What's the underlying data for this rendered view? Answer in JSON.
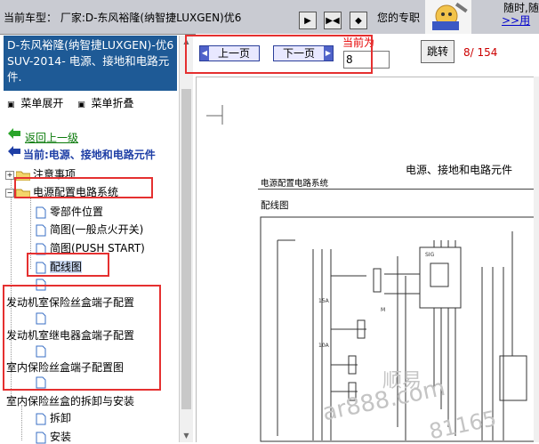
{
  "topbar": {
    "current_model_label": "当前车型：  厂家:D-东风裕隆(纳智捷LUXGEN)优6",
    "pro_text": "您的专职",
    "tip_line1": "随时,随",
    "tip_line2": ">>用"
  },
  "left": {
    "title": "D-东风裕隆(纳智捷LUXGEN)-优6 SUV-2014- 电源、接地和电路元件.",
    "menu_expand": "菜单展开",
    "menu_collapse": "菜单折叠",
    "back": "返回上一级",
    "current": "当前:电源、接地和电路元件",
    "tree": [
      {
        "label": "注意事项"
      },
      {
        "label": "电源配置电路系统"
      },
      {
        "label": "零部件位置"
      },
      {
        "label": "简图(一般点火开关)"
      },
      {
        "label": "简图(PUSH START)"
      },
      {
        "label": "配线图"
      },
      {
        "label": ""
      },
      {
        "label": "发动机室保险丝盒端子配置"
      },
      {
        "label": ""
      },
      {
        "label": "发动机室继电器盒端子配置"
      },
      {
        "label": ""
      },
      {
        "label": "室内保险丝盒端子配置图"
      },
      {
        "label": ""
      },
      {
        "label": "室内保险丝盒的拆卸与安装"
      },
      {
        "label": "拆卸"
      },
      {
        "label": "安装"
      }
    ]
  },
  "nav": {
    "prev": "上一页",
    "next": "下一页",
    "current_label": "当前为",
    "page_value": "8",
    "jump": "跳转",
    "page_count": "8/ 154"
  },
  "doc": {
    "title": "电源、接地和电路元件",
    "subtitle": "电源配置电路系统",
    "label": "配线图",
    "watermark1": "顺易",
    "watermark2": "ar888.com",
    "watermark3": "81165"
  },
  "colors": {
    "title_bg": "#1e5a96",
    "highlight": "#e53030",
    "current": "#1f3fa6",
    "back_link": "#0a7a0a"
  }
}
